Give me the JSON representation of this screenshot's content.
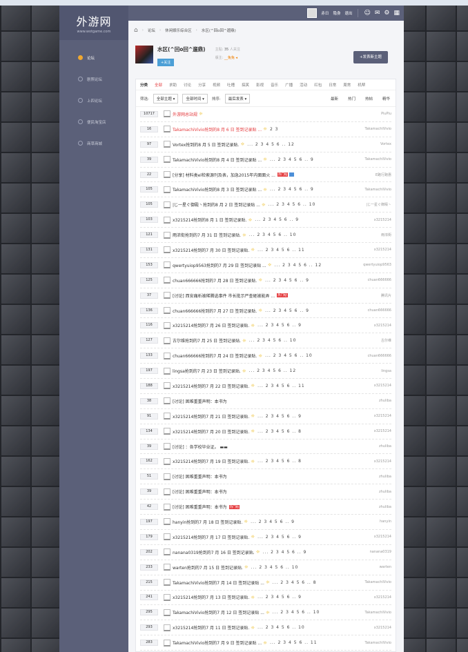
{
  "site": {
    "logo_cn": "外游网",
    "logo_en": "www.wotgame.com"
  },
  "sidebar": {
    "items": [
      {
        "label": "论坛",
        "active": true
      },
      {
        "label": "剧照论坛",
        "active": false
      },
      {
        "label": "上四论坛",
        "active": false
      },
      {
        "label": "便民淘宝店",
        "active": false
      },
      {
        "label": "商草商城",
        "active": false
      }
    ]
  },
  "topbar": {
    "user": "赤日",
    "links": [
      "隐身",
      "退出"
    ],
    "icons": [
      "user-icon",
      "mail-icon",
      "gear-icon",
      "grid-icon"
    ]
  },
  "breadcrumb": {
    "items": [
      "论坛",
      "休闲娱乐综合区",
      "水区(^回o回^遛鼎)"
    ]
  },
  "forum": {
    "title": "水区(^回o回^遛鼎)",
    "follow_label": "+关注",
    "stats_prefix": "主贴:",
    "stats_count": "35",
    "stats_suffix": "人关注",
    "moderator_label": "版主:",
    "moderator": "__兔兔 ◂",
    "new_post_label": "+发表新主题"
  },
  "categories": {
    "label": "分类",
    "items": [
      "全部",
      "求助",
      "讨论",
      "分享",
      "视频",
      "吐槽",
      "搞笑",
      "影视",
      "音乐",
      "广播",
      "活动",
      "红包",
      "日常",
      "周常",
      "机帮"
    ],
    "active": "全部"
  },
  "filters": {
    "label": "筛选:",
    "theme": "全部主题 ▾",
    "time": "全部时间 ▾",
    "sort_label": "排序:",
    "sort": "最后发表 ▾",
    "right": [
      "最新",
      "热门",
      "热帖",
      "精华"
    ]
  },
  "rows": [
    {
      "count": "10717",
      "title": "外游网总站规",
      "red": true,
      "bulb": true,
      "pages": "",
      "hot": false,
      "img": false,
      "author": "PiuPiu"
    },
    {
      "count": "16",
      "title": "TakamachiVivio抢到的8 月 6 日 签到记录贴 ...",
      "red": true,
      "bulb": true,
      "pages": "2 3",
      "hot": false,
      "img": false,
      "author": "TakamachiVivio"
    },
    {
      "count": "97",
      "title": "Vortex抢到的8 月 5 日 签到记录贴.",
      "red": false,
      "bulb": true,
      "pages": "... 2 3 4 5 6 .. 12",
      "hot": false,
      "img": false,
      "author": "Vortex"
    },
    {
      "count": "39",
      "title": "TakamachiVivio抢到的8 月 4 日 签到记录贴 ...",
      "red": false,
      "bulb": true,
      "pages": "... 2 3 4 5 6 .. 9",
      "hot": false,
      "img": false,
      "author": "TakamachiVivio"
    },
    {
      "count": "22",
      "title": "[分享] 材料类el检索源刊及表，加急2015年内面面火 ...",
      "red": false,
      "bulb": false,
      "pages": "",
      "hot": true,
      "img": true,
      "author": "E路行跑惠"
    },
    {
      "count": "105",
      "title": "TakamachiVivio抢到的8 月 3 日 签到记录贴 ...",
      "red": false,
      "bulb": true,
      "pages": "... 2 3 4 5 6 .. 9",
      "hot": false,
      "img": false,
      "author": "TakamachiVivio"
    },
    {
      "count": "105",
      "title": "|じ一星ぐ御殿丶抢到的8 月 2 日 签到记录贴 ...",
      "red": false,
      "bulb": true,
      "pages": "... 2 3 4 5 6 .. 10",
      "hot": false,
      "img": false,
      "author": "|じ一星ぐ御殿丶"
    },
    {
      "count": "103",
      "title": "x3215214抢到的8 月 1 日 签到记录贴.",
      "red": false,
      "bulb": true,
      "pages": "... 2 3 4 5 6 .. 9",
      "hot": false,
      "img": false,
      "author": "x3215214"
    },
    {
      "count": "121",
      "title": "雨浓街抢到的7 月 31 日 签到记录贴.",
      "red": false,
      "bulb": true,
      "pages": "... 2 3 4 5 6 .. 10",
      "hot": false,
      "img": false,
      "author": "雨浓街"
    },
    {
      "count": "131",
      "title": "x3215214抢到的7 月 30 日 签到记录贴.",
      "red": false,
      "bulb": true,
      "pages": "... 2 3 4 5 6 .. 11",
      "hot": false,
      "img": false,
      "author": "x3215214"
    },
    {
      "count": "153",
      "title": "qwertyuiop9563抢到的7 月 29 日 签到记录贴 ...",
      "red": false,
      "bulb": true,
      "pages": "... 2 3 4 5 6 .. 12",
      "hot": false,
      "img": false,
      "author": "qwertyuiop9563"
    },
    {
      "count": "125",
      "title": "chuan666666抢到的7 月 28 日 签到记录贴.",
      "red": false,
      "bulb": true,
      "pages": "... 2 3 4 5 6 .. 9",
      "hot": false,
      "img": false,
      "author": "chuan666666"
    },
    {
      "count": "37",
      "title": "[讨论] 西安痛析被稀腾选事件 市长批示严查砸被能弄 ...",
      "red": false,
      "bulb": false,
      "pages": "",
      "hot": true,
      "img": false,
      "author": "腾讯片"
    },
    {
      "count": "136",
      "title": "chuan666666抢到的7 月 27 日 签到记录贴.",
      "red": false,
      "bulb": true,
      "pages": "... 2 3 4 5 6 .. 9",
      "hot": false,
      "img": false,
      "author": "chuan666666"
    },
    {
      "count": "116",
      "title": "x3215214抢到的7 月 26 日 签到记录贴.",
      "red": false,
      "bulb": true,
      "pages": "... 2 3 4 5 6 .. 9",
      "hot": false,
      "img": false,
      "author": "x3215214"
    },
    {
      "count": "127",
      "title": "古尔维抢到的7 月 25 日 签到记录贴.",
      "red": false,
      "bulb": true,
      "pages": "... 2 3 4 5 6 .. 10",
      "hot": false,
      "img": false,
      "author": "古尔维"
    },
    {
      "count": "133",
      "title": "chuan666666抢到的7 月 24 日 签到记录贴.",
      "red": false,
      "bulb": true,
      "pages": "... 2 3 4 5 6 .. 10",
      "hot": false,
      "img": false,
      "author": "chuan666666"
    },
    {
      "count": "197",
      "title": "lingsa抢到的7 月 23 日 签到记录贴.",
      "red": false,
      "bulb": true,
      "pages": "... 2 3 4 5 6 .. 12",
      "hot": false,
      "img": false,
      "author": "lingsa"
    },
    {
      "count": "188",
      "title": "x3215214抢到的7 月 22 日 签到记录贴.",
      "red": false,
      "bulb": true,
      "pages": "... 2 3 4 5 6 .. 11",
      "hot": false,
      "img": false,
      "author": "x3215214"
    },
    {
      "count": "38",
      "title": "[讨论] 困难重重声明：本书为",
      "red": false,
      "bulb": false,
      "pages": "",
      "hot": false,
      "img": false,
      "author": "zhuliba"
    },
    {
      "count": "91",
      "title": "x3215214抢到的7 月 21 日 签到记录贴.",
      "red": false,
      "bulb": true,
      "pages": "... 2 3 4 5 6 .. 9",
      "hot": false,
      "img": false,
      "author": "x3215214"
    },
    {
      "count": "134",
      "title": "x3215214抢到的7 月 20 日 签到记录贴.",
      "red": false,
      "bulb": true,
      "pages": "... 2 3 4 5 6 .. 8",
      "hot": false,
      "img": false,
      "author": "x3215214"
    },
    {
      "count": "39",
      "title": "[讨论] ：各学校毕业证。 ▬▬",
      "red": false,
      "bulb": false,
      "pages": "",
      "hot": false,
      "img": false,
      "author": "zhuliba"
    },
    {
      "count": "162",
      "title": "x3215214抢到的7 月 19 日 签到记录贴.",
      "red": false,
      "bulb": true,
      "pages": "... 2 3 4 5 6 .. 8",
      "hot": false,
      "img": false,
      "author": "x3215214"
    },
    {
      "count": "51",
      "title": "[讨论] 困难重重声明：本书为",
      "red": false,
      "bulb": false,
      "pages": "",
      "hot": false,
      "img": false,
      "author": "zhuliba"
    },
    {
      "count": "39",
      "title": "[讨论] 困难重重声明：本书为",
      "red": false,
      "bulb": false,
      "pages": "",
      "hot": false,
      "img": false,
      "author": "zhuliba"
    },
    {
      "count": "42",
      "title": "[讨论] 困难重重声明：本书为",
      "red": false,
      "bulb": false,
      "pages": "",
      "hot": true,
      "img": false,
      "author": "zhuliba"
    },
    {
      "count": "197",
      "title": "hanyin抢到的7 月 18 日 签到记录贴.",
      "red": false,
      "bulb": true,
      "pages": "... 2 3 4 5 6 .. 9",
      "hot": false,
      "img": false,
      "author": "hanyin"
    },
    {
      "count": "179",
      "title": "x3215214抢到的7 月 17 日 签到记录贴.",
      "red": false,
      "bulb": true,
      "pages": "... 2 3 4 5 6 .. 9",
      "hot": false,
      "img": false,
      "author": "x3215214"
    },
    {
      "count": "202",
      "title": "nanana0319抢到的7 月 16 日 签到记录贴.",
      "red": false,
      "bulb": true,
      "pages": "... 2 3 4 5 6 .. 9",
      "hot": false,
      "img": false,
      "author": "nanana0319"
    },
    {
      "count": "233",
      "title": "warten抢到的7 月 15 日 签到记录贴.",
      "red": false,
      "bulb": true,
      "pages": "... 2 3 4 5 6 .. 10",
      "hot": false,
      "img": false,
      "author": "warten"
    },
    {
      "count": "215",
      "title": "TakamachiVivio抢到的7 月 14 日 签到记录贴 ...",
      "red": false,
      "bulb": true,
      "pages": "... 2 3 4 5 6 .. 8",
      "hot": false,
      "img": false,
      "author": "TakamachiVivio"
    },
    {
      "count": "241",
      "title": "x3215214抢到的7 月 13 日 签到记录贴.",
      "red": false,
      "bulb": true,
      "pages": "... 2 3 4 5 6 .. 9",
      "hot": false,
      "img": false,
      "author": "x3215214"
    },
    {
      "count": "295",
      "title": "TakamachiVivio抢到的7 月 12 日 签到记录贴 ...",
      "red": false,
      "bulb": true,
      "pages": "... 2 3 4 5 6 .. 10",
      "hot": false,
      "img": false,
      "author": "TakamachiVivio"
    },
    {
      "count": "293",
      "title": "x3215214抢到的7 月 11 日 签到记录贴.",
      "red": false,
      "bulb": true,
      "pages": "... 2 3 4 5 6 .. 10",
      "hot": false,
      "img": false,
      "author": "x3215214"
    },
    {
      "count": "283",
      "title": "TakamachiVivio抢到的7 月 9 日 签到记录贴 ...",
      "red": false,
      "bulb": true,
      "pages": "... 2 3 4 5 6 .. 11",
      "hot": false,
      "img": false,
      "author": "TakamachiVivio"
    }
  ],
  "hot_label": "热门帖",
  "colors": {
    "sidebar": "#5b6079",
    "accent_red": "#e4393c",
    "follow_blue": "#4c9fd6"
  }
}
